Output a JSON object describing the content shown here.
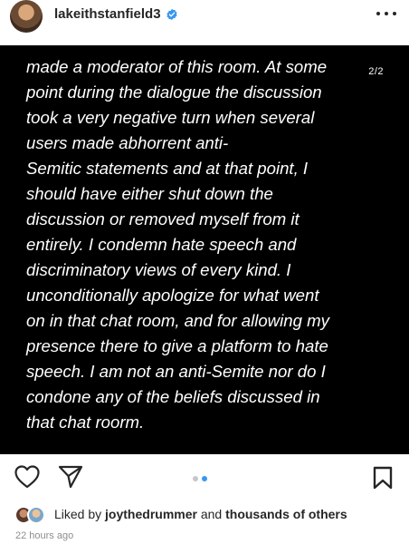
{
  "header": {
    "username": "lakeithstanfield3"
  },
  "post": {
    "counter": "2/2",
    "lines": [
      "made a moderator of this room. At some",
      "point during the dialogue the discussion",
      "took a very negative turn when several",
      "users made abhorrent anti-",
      "Semitic statements and at that point, I",
      "should have either shut down the",
      "discussion or removed myself from it",
      "entirely.  I condemn hate speech and",
      "discriminatory views of every kind.  I",
      "unconditionally apologize for what went",
      "on in that chat room, and for allowing my",
      "presence there to give a platform to hate",
      "speech. I am not an anti-Semite nor do I",
      "condone any of the beliefs discussed in",
      "that chat roorm."
    ]
  },
  "carousel": {
    "pages": 2,
    "active": 2
  },
  "likes": {
    "prefix": "Liked by",
    "user": "joythedrummer",
    "and": "and",
    "others": "thousands of others"
  },
  "timestamp": "22 hours ago",
  "colors": {
    "verified": "#3897f0",
    "accent": "#3897f0",
    "dot_inactive": "#c7c7c7",
    "post_bg": "#000000"
  },
  "icons": [
    "verified-badge-icon",
    "more-options-icon",
    "heart-icon",
    "share-icon",
    "bookmark-icon"
  ]
}
